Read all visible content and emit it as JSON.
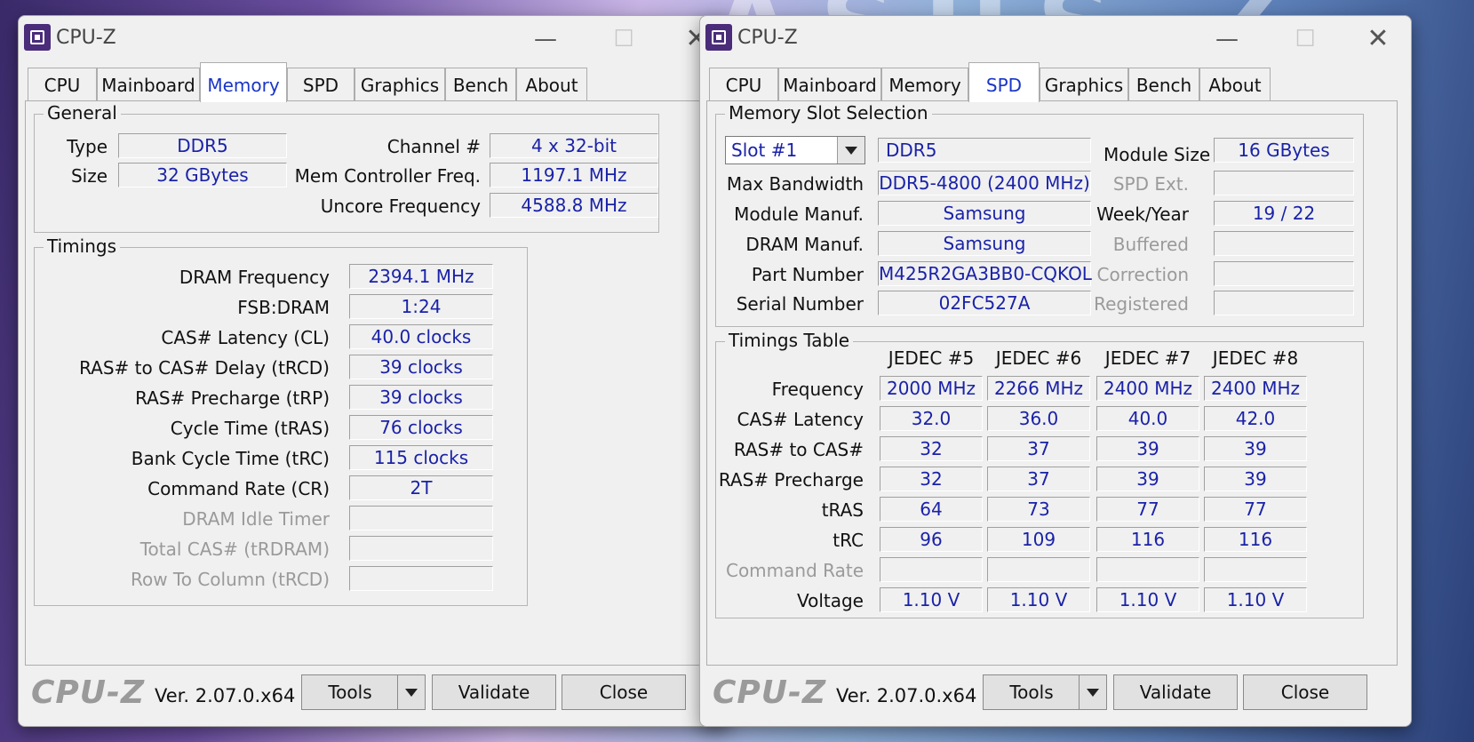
{
  "app_title": "CPU-Z",
  "bg_text": "ASUS Z",
  "tabs": [
    "CPU",
    "Mainboard",
    "Memory",
    "SPD",
    "Graphics",
    "Bench",
    "About"
  ],
  "footer": {
    "logo": "CPU-Z",
    "version": "Ver. 2.07.0.x64",
    "tools": "Tools",
    "validate": "Validate",
    "close": "Close"
  },
  "memory": {
    "active_tab": "Memory",
    "general": {
      "label": "General",
      "type_label": "Type",
      "type": "DDR5",
      "size_label": "Size",
      "size": "32 GBytes",
      "channel_label": "Channel #",
      "channel": "4 x 32-bit",
      "mcfreq_label": "Mem Controller Freq.",
      "mcfreq": "1197.1 MHz",
      "uncore_label": "Uncore Frequency",
      "uncore": "4588.8 MHz"
    },
    "timings": {
      "label": "Timings",
      "rows": [
        {
          "label": "DRAM Frequency",
          "value": "2394.1 MHz"
        },
        {
          "label": "FSB:DRAM",
          "value": "1:24"
        },
        {
          "label": "CAS# Latency (CL)",
          "value": "40.0 clocks"
        },
        {
          "label": "RAS# to CAS# Delay (tRCD)",
          "value": "39 clocks"
        },
        {
          "label": "RAS# Precharge (tRP)",
          "value": "39 clocks"
        },
        {
          "label": "Cycle Time (tRAS)",
          "value": "76 clocks"
        },
        {
          "label": "Bank Cycle Time (tRC)",
          "value": "115 clocks"
        },
        {
          "label": "Command Rate (CR)",
          "value": "2T"
        },
        {
          "label": "DRAM Idle Timer",
          "value": ""
        },
        {
          "label": "Total CAS# (tRDRAM)",
          "value": ""
        },
        {
          "label": "Row To Column (tRCD)",
          "value": ""
        }
      ]
    }
  },
  "spd": {
    "active_tab": "SPD",
    "slot": {
      "label": "Memory Slot Selection",
      "selected": "Slot #1",
      "type": "DDR5",
      "module_size_label": "Module Size",
      "module_size": "16 GBytes",
      "max_bw_label": "Max Bandwidth",
      "max_bw": "DDR5-4800 (2400 MHz)",
      "spd_ext_label": "SPD Ext.",
      "spd_ext": "",
      "module_manuf_label": "Module Manuf.",
      "module_manuf": "Samsung",
      "week_year_label": "Week/Year",
      "week_year": "19 / 22",
      "dram_manuf_label": "DRAM Manuf.",
      "dram_manuf": "Samsung",
      "buffered_label": "Buffered",
      "buffered": "",
      "part_label": "Part Number",
      "part": "M425R2GA3BB0-CQKOL",
      "correction_label": "Correction",
      "correction": "",
      "serial_label": "Serial Number",
      "serial": "02FC527A",
      "registered_label": "Registered",
      "registered": ""
    },
    "timings_table": {
      "label": "Timings Table",
      "columns": [
        "JEDEC #5",
        "JEDEC #6",
        "JEDEC #7",
        "JEDEC #8"
      ],
      "rows": [
        {
          "label": "Frequency",
          "values": [
            "2000 MHz",
            "2266 MHz",
            "2400 MHz",
            "2400 MHz"
          ]
        },
        {
          "label": "CAS# Latency",
          "values": [
            "32.0",
            "36.0",
            "40.0",
            "42.0"
          ]
        },
        {
          "label": "RAS# to CAS#",
          "values": [
            "32",
            "37",
            "39",
            "39"
          ]
        },
        {
          "label": "RAS# Precharge",
          "values": [
            "32",
            "37",
            "39",
            "39"
          ]
        },
        {
          "label": "tRAS",
          "values": [
            "64",
            "73",
            "77",
            "77"
          ]
        },
        {
          "label": "tRC",
          "values": [
            "96",
            "109",
            "116",
            "116"
          ]
        },
        {
          "label": "Command Rate",
          "values": [
            "",
            "",
            "",
            ""
          ]
        },
        {
          "label": "Voltage",
          "values": [
            "1.10 V",
            "1.10 V",
            "1.10 V",
            "1.10 V"
          ]
        }
      ]
    }
  }
}
